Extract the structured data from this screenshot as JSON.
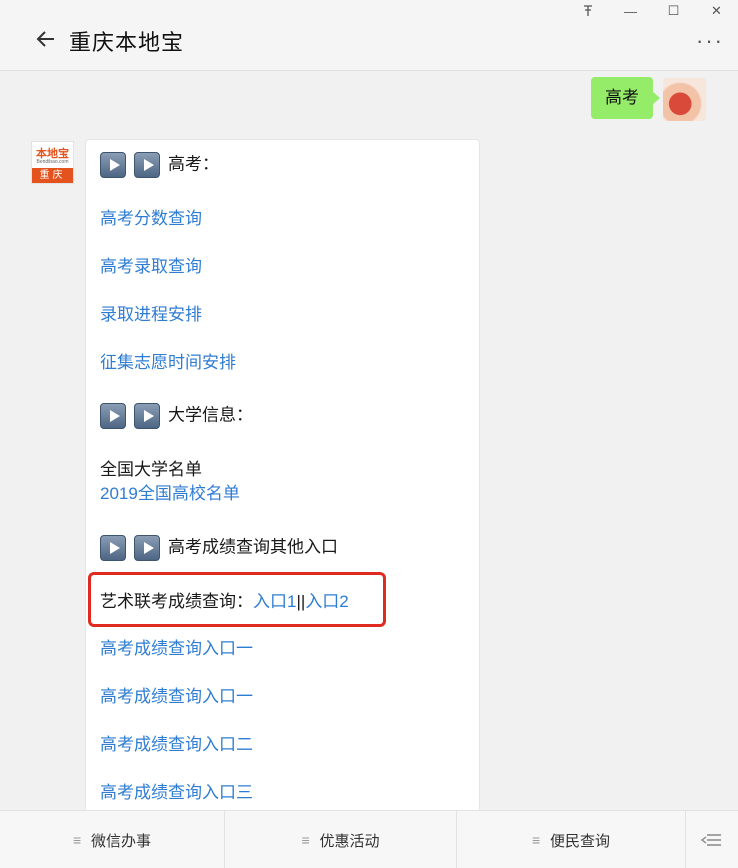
{
  "window": {
    "pin_icon": "pin-icon",
    "minimize": "—",
    "maximize": "☐",
    "close": "✕"
  },
  "header": {
    "title": "重庆本地宝",
    "more": "···"
  },
  "my_message": {
    "text": "高考"
  },
  "bot_avatar": {
    "logo_top": "本地宝",
    "logo_url": "Bendibao.com",
    "logo_bar": "重庆"
  },
  "bubble": {
    "section1": "高考：",
    "link1": "高考分数查询",
    "link2": "高考录取查询",
    "link3": "录取进程安排",
    "link4": "征集志愿时间安排",
    "section2": "大学信息：",
    "plain1": "全国大学名单",
    "link5": "2019全国高校名单",
    "section3": "高考成绩查询其他入口",
    "art_label": "艺术联考成绩查询：",
    "art_link1": "入口1",
    "art_sep": "||",
    "art_link2": "入口2",
    "link6": "高考成绩查询入口一",
    "link7": "高考成绩查询入口一",
    "link8": "高考成绩查询入口二",
    "link9": "高考成绩查询入口三"
  },
  "menu": {
    "item1": "微信办事",
    "item2": "优惠活动",
    "item3": "便民查询"
  },
  "colors": {
    "accent_link": "#2f7dd3",
    "my_bubble": "#95ec69",
    "highlight": "#e02a1f",
    "logo_orange": "#e4531d"
  }
}
